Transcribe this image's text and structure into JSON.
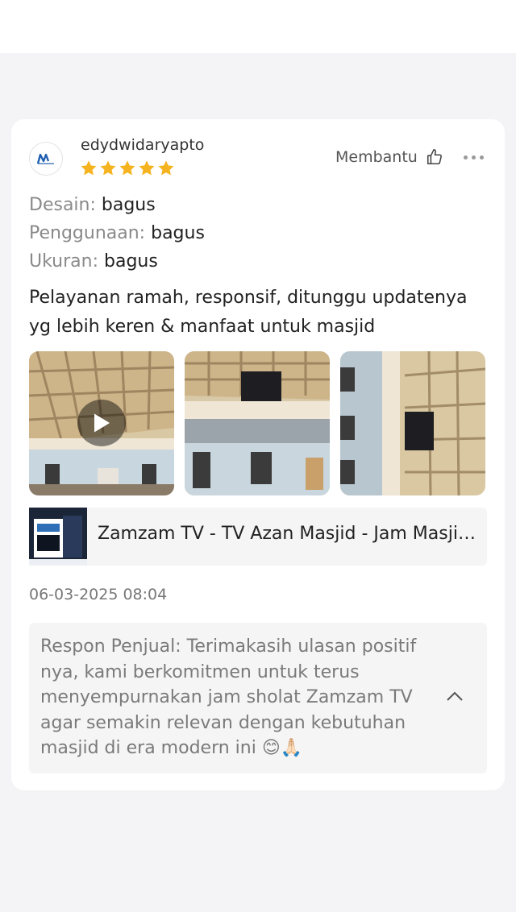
{
  "review": {
    "username": "edydwidaryapto",
    "rating": 5,
    "helpful_label": "Membantu",
    "attributes": [
      {
        "key": "Desain:",
        "value": "bagus"
      },
      {
        "key": "Penggunaan:",
        "value": "bagus"
      },
      {
        "key": "Ukuran:",
        "value": "bagus"
      }
    ],
    "text": "Pelayanan ramah, responsif, ditunggu updatenya yg lebih keren & manfaat untuk masjid",
    "date": "06-03-2025 08:04"
  },
  "media": [
    {
      "type": "video",
      "icon": "play-icon"
    },
    {
      "type": "photo"
    },
    {
      "type": "photo"
    }
  ],
  "product": {
    "title": "Zamzam TV - TV Azan Masjid - Jam Masjid Digital"
  },
  "seller_response": {
    "text": "Respon Penjual: Terimakasih ulasan positif nya, kami berkomitmen untuk terus menyempurnakan jam sholat Zamzam TV agar semakin relevan dengan kebutuhan masjid di era modern ini 😊🙏🏻"
  },
  "colors": {
    "star": "#f5b320",
    "page_bg": "#f4f4f6",
    "card_bg": "#ffffff",
    "panel_bg": "#f5f5f5"
  }
}
